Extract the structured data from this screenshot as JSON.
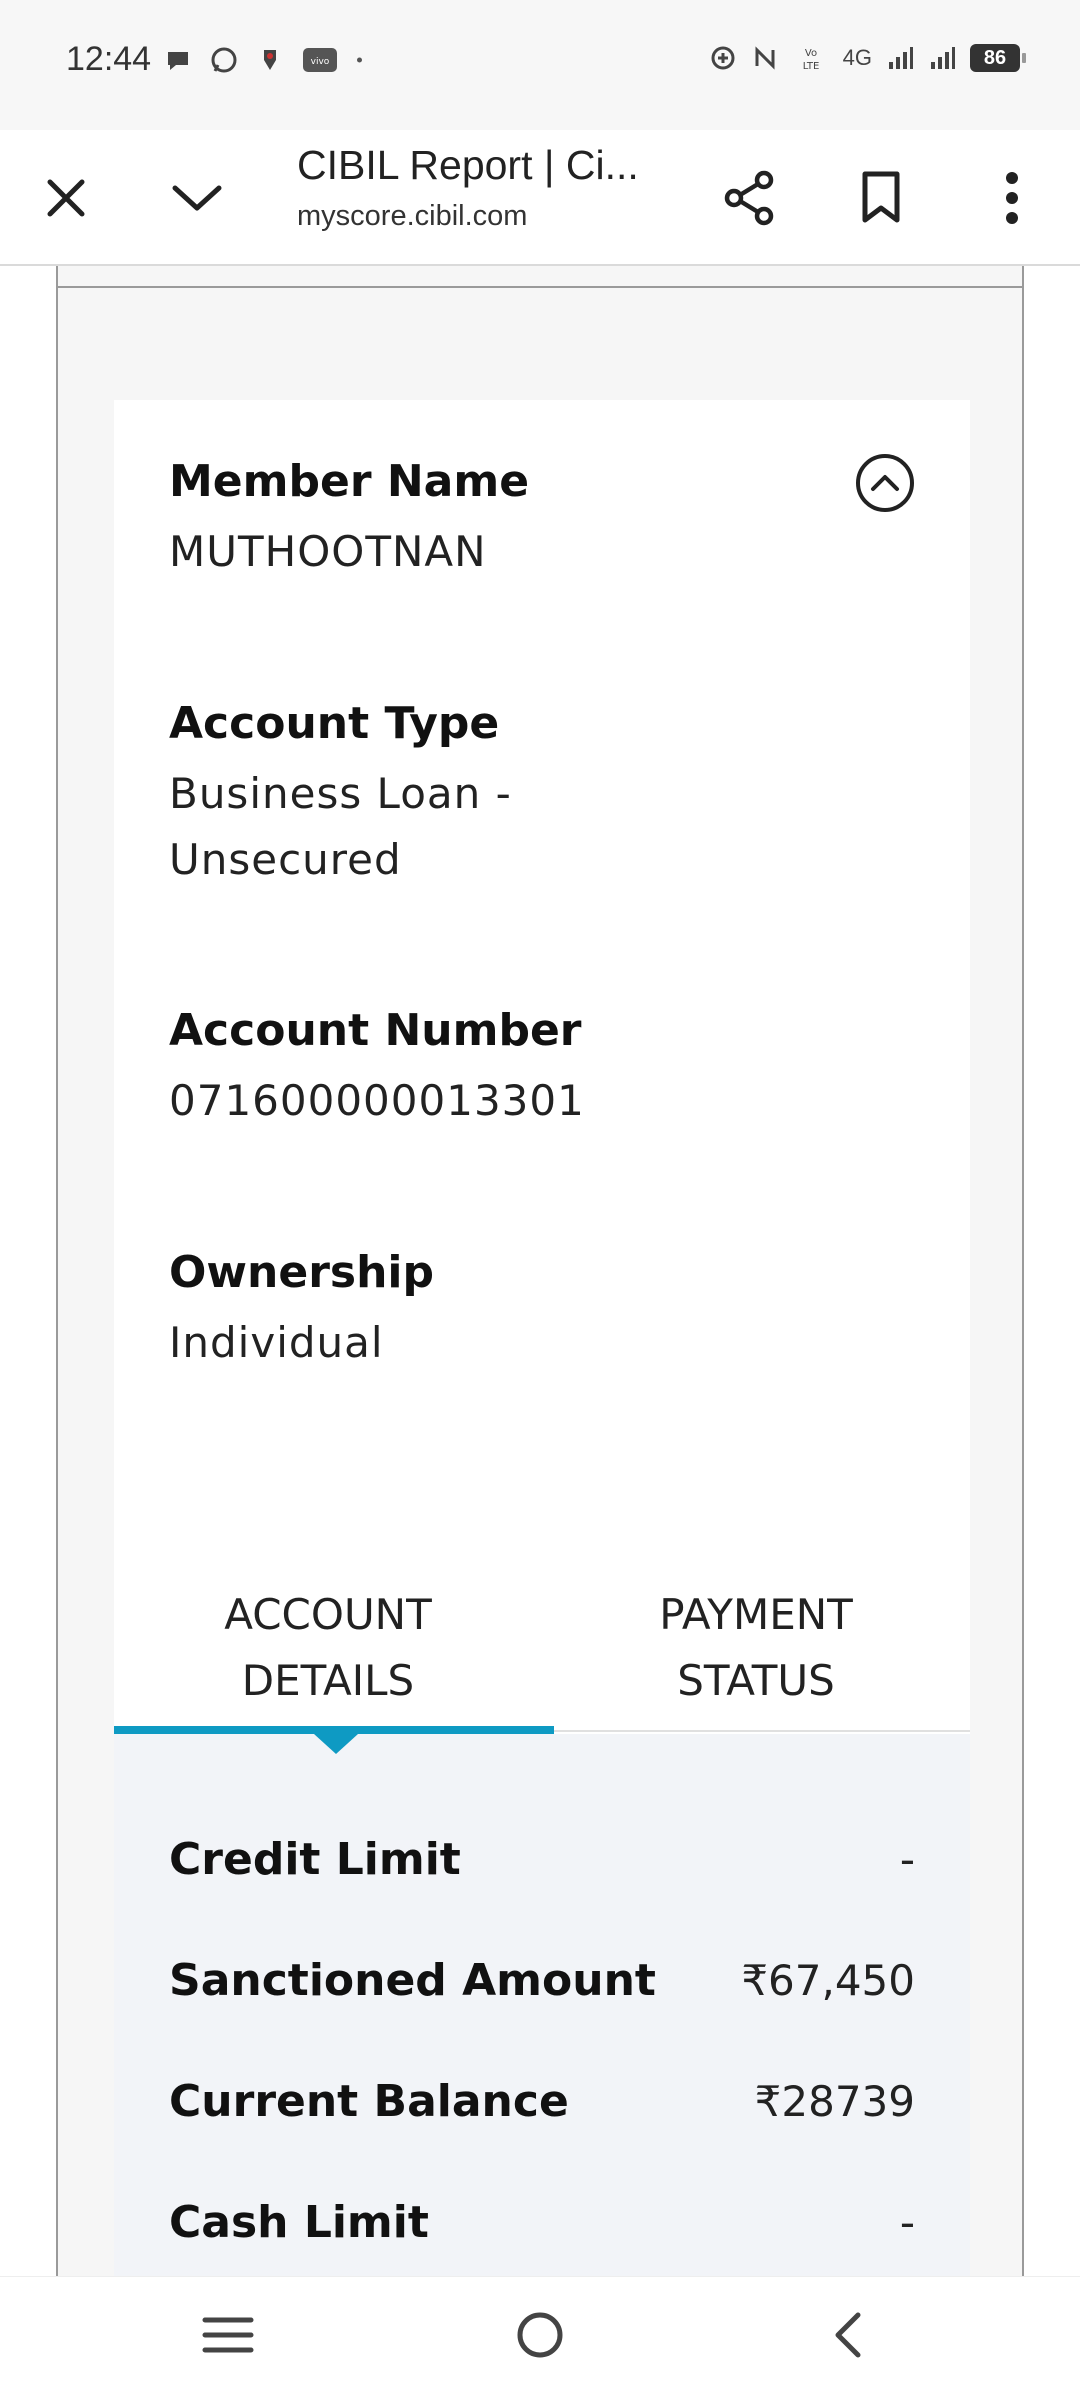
{
  "status_bar": {
    "time": "12:44",
    "network": "4G",
    "battery": "86",
    "left_icons": [
      "chat-icon",
      "whatsapp-icon",
      "app-icon",
      "vivo-icon",
      "dot-icon"
    ],
    "right_icons": [
      "data-saver-icon",
      "nfc-icon",
      "volte-icon",
      "signal-icon",
      "signal-icon-2",
      "battery-icon"
    ]
  },
  "browser": {
    "title": "CIBIL Report | Ci...",
    "url": "myscore.cibil.com"
  },
  "account": {
    "member_name_label": "Member Name",
    "member_name_value": "MUTHOOTNAN",
    "account_type_label": "Account Type",
    "account_type_value": "Business Loan -\nUnsecured",
    "account_number_label": "Account Number",
    "account_number_value": "071600000013301",
    "ownership_label": "Ownership",
    "ownership_value": "Individual"
  },
  "tabs": [
    {
      "label": "ACCOUNT\nDETAILS",
      "active": true
    },
    {
      "label": "PAYMENT\nSTATUS",
      "active": false
    }
  ],
  "details": [
    {
      "label": "Credit Limit",
      "value": "-"
    },
    {
      "label": "Sanctioned Amount",
      "value": "₹67,450"
    },
    {
      "label": "Current Balance",
      "value": "₹28739"
    },
    {
      "label": "Cash Limit",
      "value": "-"
    }
  ],
  "colors": {
    "accent": "#0e9ac3",
    "details_bg": "#f2f4f8"
  }
}
